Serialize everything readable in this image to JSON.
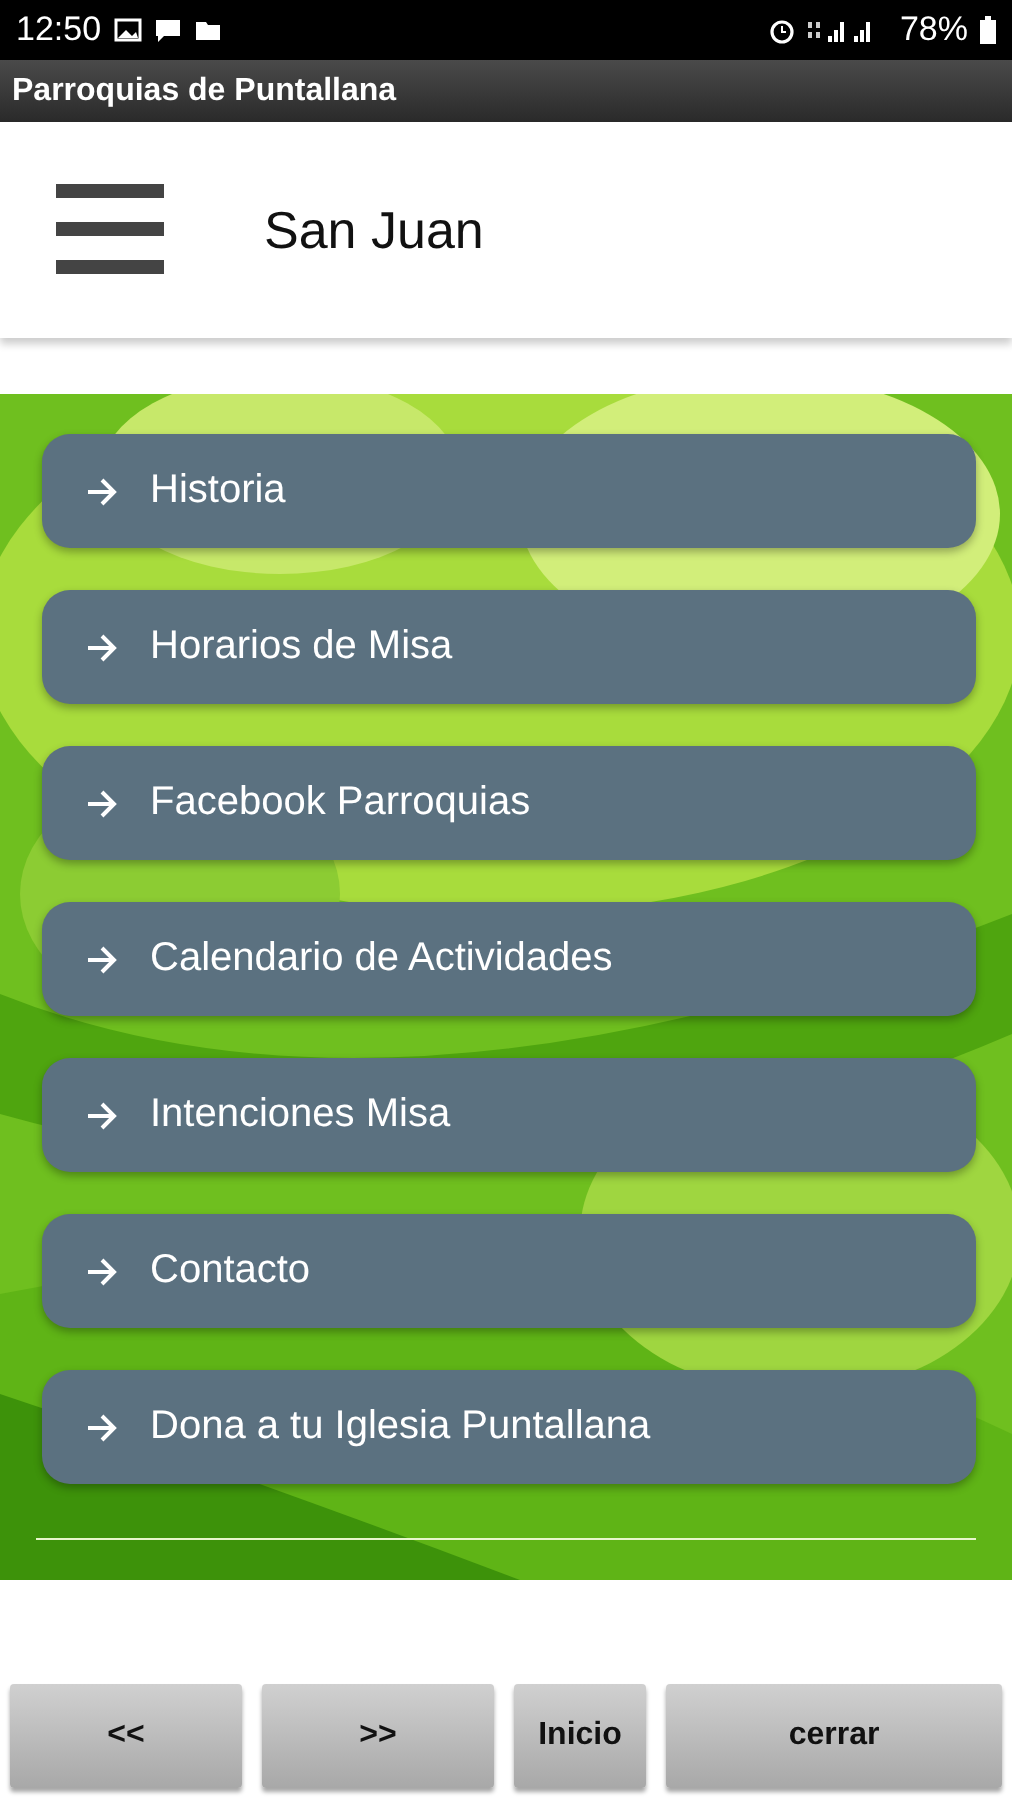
{
  "status_bar": {
    "time": "12:50",
    "battery": "78%"
  },
  "app_bar": {
    "title": "Parroquias de Puntallana"
  },
  "header": {
    "title": "San Juan"
  },
  "menu": [
    {
      "label": "Historia"
    },
    {
      "label": "Horarios de Misa"
    },
    {
      "label": "Facebook Parroquias"
    },
    {
      "label": "Calendario de Actividades"
    },
    {
      "label": "Intenciones Misa"
    },
    {
      "label": "Contacto"
    },
    {
      "label": "Dona a tu Iglesia Puntallana"
    }
  ],
  "buttons": [
    {
      "label": "<<",
      "kind": "wide"
    },
    {
      "label": ">>",
      "kind": "wide"
    },
    {
      "label": "Inicio",
      "kind": "narrow"
    },
    {
      "label": "cerrar",
      "kind": "large"
    }
  ]
}
